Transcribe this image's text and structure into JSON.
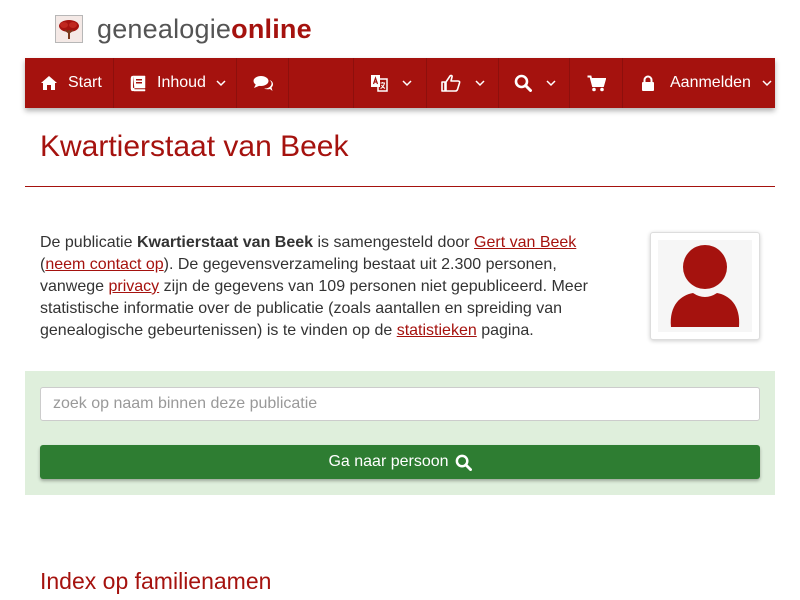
{
  "brand": {
    "name_part1": "genealogie",
    "name_part2": "online",
    "logo_icon": "tree-icon"
  },
  "nav": {
    "start_label": "Start",
    "start_icon": "home-icon",
    "inhoud_label": "Inhoud",
    "inhoud_icon": "book-icon",
    "comments_icon": "comments-icon",
    "language_icon": "translate-icon",
    "like_icon": "thumbs-up-icon",
    "search_icon": "search-icon",
    "cart_icon": "shopping-cart-icon",
    "login_label": "Aanmelden",
    "login_icon": "lock-icon"
  },
  "page": {
    "title": "Kwartierstaat van Beek"
  },
  "intro": {
    "t1": "De publicatie ",
    "publication": "Kwartierstaat van Beek",
    "t2": " is samengesteld door ",
    "author_link": "Gert van Beek",
    "t3": " (",
    "contact_link": "neem contact op",
    "t4": "). De gegevensverzameling bestaat uit 2.300 personen, vanwege ",
    "privacy_link": "privacy",
    "t5": " zijn de gegevens van 109 personen niet gepubliceerd. Meer statistische informatie over de publicatie (zoals aantallen en spreiding van genealogische gebeurtenissen) is te vinden op de ",
    "stats_link": "statistieken",
    "t6": " pagina."
  },
  "search": {
    "placeholder": "zoek op naam binnen deze publicatie",
    "value": "",
    "button_label": "Ga naar persoon "
  },
  "section": {
    "index_title": "Index op familienamen"
  },
  "colors": {
    "brand_red": "#a5120e",
    "button_green": "#2e7d32",
    "panel_green": "#dfefdc"
  }
}
